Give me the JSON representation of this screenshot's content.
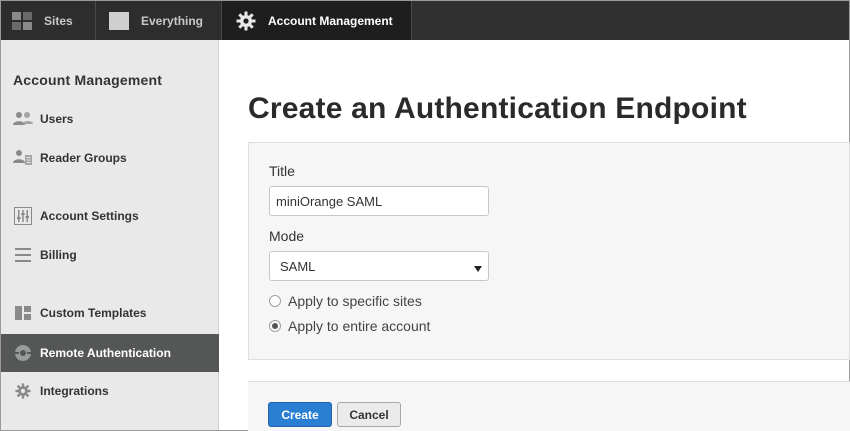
{
  "topbar": {
    "tabs": [
      {
        "label": "Sites",
        "icon": "grid-icon"
      },
      {
        "label": "Everything",
        "icon": "square-icon"
      },
      {
        "label": "Account Management",
        "icon": "gear-icon",
        "active": true
      }
    ]
  },
  "sidebar": {
    "heading": "Account Management",
    "items": [
      {
        "label": "Users",
        "icon": "users-icon"
      },
      {
        "label": "Reader Groups",
        "icon": "reader-groups-icon"
      },
      {
        "label": "Account Settings",
        "icon": "sliders-icon"
      },
      {
        "label": "Billing",
        "icon": "list-icon"
      },
      {
        "label": "Custom Templates",
        "icon": "template-icon"
      },
      {
        "label": "Remote Authentication",
        "icon": "remote-auth-icon",
        "active": true
      },
      {
        "label": "Integrations",
        "icon": "cog-icon"
      }
    ]
  },
  "main": {
    "title": "Create an Authentication Endpoint",
    "form": {
      "title_label": "Title",
      "title_value": "miniOrange SAML",
      "mode_label": "Mode",
      "mode_value": "SAML",
      "radios": [
        {
          "label": "Apply to specific sites",
          "checked": false
        },
        {
          "label": "Apply to entire account",
          "checked": true
        }
      ]
    },
    "buttons": {
      "create": "Create",
      "cancel": "Cancel"
    }
  },
  "colors": {
    "topbar_bg": "#2d2d2d",
    "active_tab_bg": "#1e1e1e",
    "sidebar_bg": "#e9e9e9",
    "sidebar_active_bg": "#555757",
    "primary_button": "#2a7fd2"
  }
}
